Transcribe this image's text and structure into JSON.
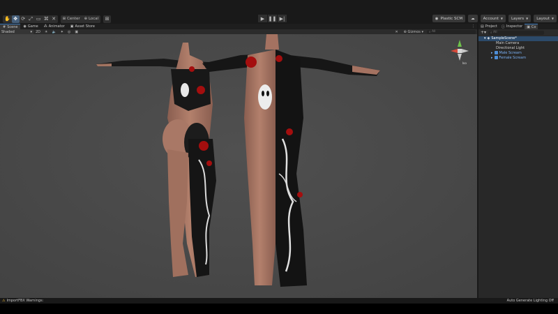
{
  "toolbar": {
    "center_label": "Center",
    "local_label": "Local",
    "plastic_label": "Plastic SCM",
    "account_label": "Account",
    "layers_label": "Layers",
    "layout_label": "Layout"
  },
  "tabs": {
    "scene": "Scene",
    "game": "Game",
    "animator": "Animator",
    "asset_store": "Asset Store"
  },
  "scene_toolbar": {
    "shading_mode": "Shaded",
    "mode_2d": "2D",
    "gizmos_label": "Gizmos",
    "search_placeholder": "All"
  },
  "viewport": {
    "projection_label": "Iso",
    "colors": {
      "background": "#4a4a4a",
      "skin": "#a47260",
      "suit": "#141414",
      "blood": "#b01010"
    }
  },
  "right_panel": {
    "tabs": {
      "project": "Project",
      "inspector": "Inspector",
      "console": "Co"
    },
    "search_placeholder": "All",
    "hierarchy": {
      "scene_name": "SampleScene*",
      "items": [
        {
          "label": "Main Camera",
          "kind": "gameobject"
        },
        {
          "label": "Directional Light",
          "kind": "gameobject"
        },
        {
          "label": "Male Scream",
          "kind": "prefab"
        },
        {
          "label": "Female Scream",
          "kind": "prefab"
        }
      ]
    }
  },
  "status": {
    "warning_text": "ImportFBX Warnings:",
    "lighting_text": "Auto Generate Lighting Off"
  }
}
